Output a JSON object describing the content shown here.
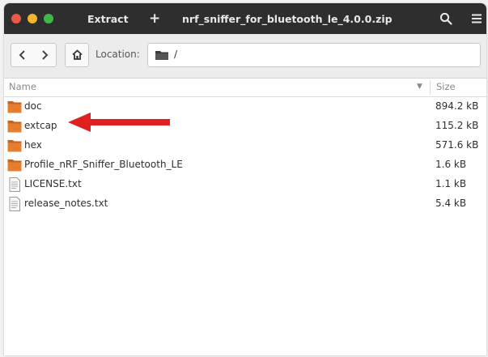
{
  "titlebar": {
    "extract_label": "Extract",
    "add_label": "+",
    "title": "nrf_sniffer_for_bluetooth_le_4.0.0.zip",
    "search_icon": "search-icon",
    "menu_icon": "hamburger-menu-icon"
  },
  "toolbar": {
    "back_icon": "chevron-left-icon",
    "forward_icon": "chevron-right-icon",
    "home_icon": "home-icon",
    "location_label": "Location:",
    "location_path": "/"
  },
  "columns": {
    "name": "Name",
    "size": "Size"
  },
  "files": [
    {
      "name": "doc",
      "size": "894.2 kB",
      "type": "folder"
    },
    {
      "name": "extcap",
      "size": "115.2 kB",
      "type": "folder"
    },
    {
      "name": "hex",
      "size": "571.6 kB",
      "type": "folder"
    },
    {
      "name": "Profile_nRF_Sniffer_Bluetooth_LE",
      "size": "1.6 kB",
      "type": "folder"
    },
    {
      "name": "LICENSE.txt",
      "size": "1.1 kB",
      "type": "text-file"
    },
    {
      "name": "release_notes.txt",
      "size": "5.4 kB",
      "type": "text-file"
    }
  ],
  "annotation": {
    "arrow_color": "#e02020",
    "points_to": "extcap"
  },
  "colors": {
    "titlebar": "#2e2e2e",
    "folder_orange": "#e0782a",
    "close": "#e85a4a",
    "minimize": "#f2b530",
    "maximize": "#3cb84a"
  }
}
